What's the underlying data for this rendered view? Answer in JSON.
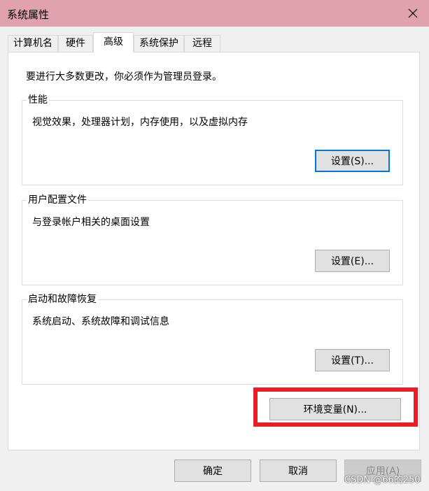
{
  "window": {
    "title": "系统属性"
  },
  "tabs": [
    {
      "label": "计算机名",
      "active": false
    },
    {
      "label": "硬件",
      "active": false
    },
    {
      "label": "高级",
      "active": true
    },
    {
      "label": "系统保护",
      "active": false
    },
    {
      "label": "远程",
      "active": false
    }
  ],
  "notice": "要进行大多数更改，你必须作为管理员登录。",
  "groups": {
    "performance": {
      "title": "性能",
      "description": "视觉效果，处理器计划，内存使用，以及虚拟内存",
      "button": "设置(S)..."
    },
    "user_profiles": {
      "title": "用户配置文件",
      "description": "与登录帐户相关的桌面设置",
      "button": "设置(E)..."
    },
    "startup_recovery": {
      "title": "启动和故障恢复",
      "description": "系统启动、系统故障和调试信息",
      "button": "设置(T)..."
    }
  },
  "env_button": "环境变量(N)...",
  "footer": {
    "ok": "确定",
    "cancel": "取消",
    "apply": "应用(A)"
  },
  "watermark": "CSDN @66的250",
  "colors": {
    "titlebar": "#e0a3ad",
    "highlight": "#ea1d26",
    "focus": "#0078d7"
  }
}
